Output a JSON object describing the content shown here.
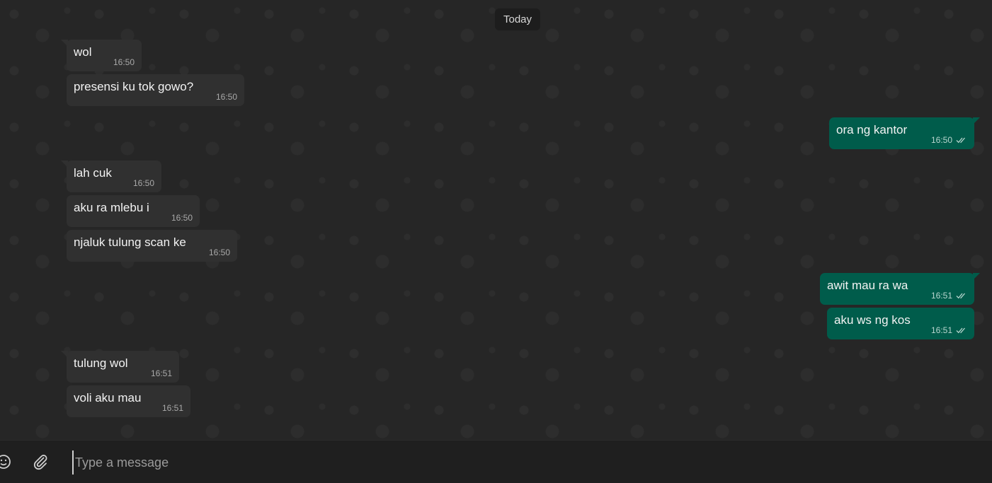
{
  "chat": {
    "date_label": "Today",
    "messages": [
      {
        "text": "wol",
        "time": "16:50"
      },
      {
        "text": "presensi ku tok gowo?",
        "time": "16:50"
      },
      {
        "text": "ora ng kantor",
        "time": "16:50"
      },
      {
        "text": "lah cuk",
        "time": "16:50"
      },
      {
        "text": "aku ra mlebu i",
        "time": "16:50"
      },
      {
        "text": "njaluk tulung scan ke",
        "time": "16:50"
      },
      {
        "text": "awit mau ra wa",
        "time": "16:51"
      },
      {
        "text": "aku ws ng kos",
        "time": "16:51"
      },
      {
        "text": "tulung wol",
        "time": "16:51"
      },
      {
        "text": "voli aku mau",
        "time": "16:51"
      }
    ]
  },
  "composer": {
    "placeholder": "Type a message",
    "emoji_icon": "smiley-icon",
    "attach_icon": "paperclip-icon"
  },
  "colors": {
    "chat_background": "#262626",
    "incoming_bubble": "#303030",
    "outgoing_bubble": "#005c4b",
    "composer_background": "#1f1f1f"
  }
}
